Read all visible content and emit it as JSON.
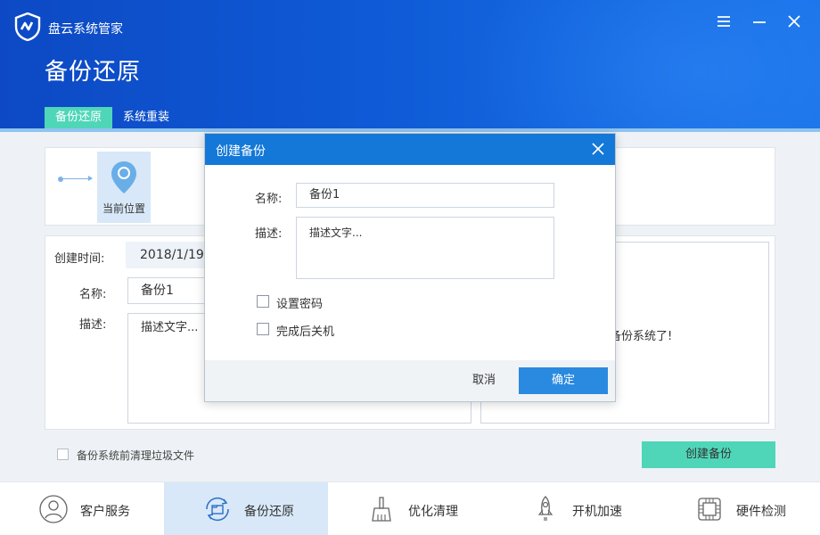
{
  "app": {
    "title": "盘云系统管家",
    "page_title": "备份还原"
  },
  "tabs": [
    {
      "label": "备份还原",
      "active": true
    },
    {
      "label": "系统重装",
      "active": false
    }
  ],
  "timeline": {
    "current_label": "当前位置"
  },
  "info": {
    "created_label": "创建时间:",
    "created_value": "2018/1/19",
    "name_label": "名称:",
    "name_value": "备份1",
    "desc_label": "描述:",
    "desc_value": "描述文字...",
    "right_message": "备份系统了!"
  },
  "bottom": {
    "clean_checkbox_label": "备份系统前清理垃圾文件",
    "create_button": "创建备份"
  },
  "footer": [
    {
      "label": "客户服务",
      "icon": "user-icon",
      "active": false
    },
    {
      "label": "备份还原",
      "icon": "backup-icon",
      "active": true
    },
    {
      "label": "优化清理",
      "icon": "broom-icon",
      "active": false
    },
    {
      "label": "开机加速",
      "icon": "rocket-icon",
      "active": false
    },
    {
      "label": "硬件检测",
      "icon": "chip-icon",
      "active": false
    }
  ],
  "dialog": {
    "title": "创建备份",
    "name_label": "名称:",
    "name_value": "备份1",
    "desc_label": "描述:",
    "desc_value": "描述文字...",
    "set_password_label": "设置密码",
    "shutdown_label": "完成后关机",
    "cancel_label": "取消",
    "ok_label": "确定"
  },
  "colors": {
    "header_blue": "#0f5ad6",
    "accent_green": "#4fd6b8",
    "dialog_blue": "#1478d8",
    "ok_blue": "#2a8ae0"
  }
}
